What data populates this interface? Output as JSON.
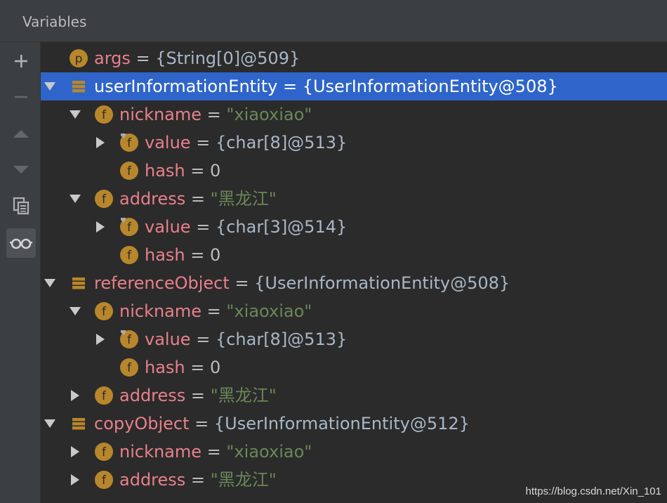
{
  "panel": {
    "title": "Variables"
  },
  "toolbar": {
    "buttons": [
      {
        "icon": "plus-icon"
      },
      {
        "icon": "minus-icon"
      },
      {
        "icon": "arrow-up-icon"
      },
      {
        "icon": "arrow-down-icon"
      },
      {
        "icon": "copy-icon"
      },
      {
        "icon": "glasses-icon"
      }
    ]
  },
  "colors": {
    "selection": "#2f65ca",
    "field_name": "#e8808c",
    "string_value": "#6a8759",
    "object_value": "#a9b7c6",
    "icon_badge": "#b8862b"
  },
  "tree": {
    "rows": [
      {
        "depth": 0,
        "expand": "none",
        "icon": "param-p-icon",
        "name": "args",
        "eq": " = ",
        "value": "{String[0]@509}",
        "value_type": "obj"
      },
      {
        "depth": 0,
        "expand": "expanded",
        "icon": "object-icon",
        "name": "userInformationEntity",
        "eq": " = ",
        "value": "{UserInformationEntity@508}",
        "value_type": "obj",
        "selected": true
      },
      {
        "depth": 1,
        "expand": "expanded",
        "icon": "field-f-icon",
        "name": "nickname",
        "eq": " = ",
        "value": "\"xiaoxiao\"",
        "value_type": "str"
      },
      {
        "depth": 2,
        "expand": "collapsed",
        "icon": "field-final-icon",
        "name": "value",
        "eq": " = ",
        "value": "{char[8]@513}",
        "value_type": "obj"
      },
      {
        "depth": 2,
        "expand": "none",
        "icon": "field-f-icon",
        "name": "hash",
        "eq": " = ",
        "value": "0",
        "value_type": "num"
      },
      {
        "depth": 1,
        "expand": "expanded",
        "icon": "field-f-icon",
        "name": "address",
        "eq": " = ",
        "value": "\"黑龙江\"",
        "value_type": "str"
      },
      {
        "depth": 2,
        "expand": "collapsed",
        "icon": "field-final-icon",
        "name": "value",
        "eq": " = ",
        "value": "{char[3]@514}",
        "value_type": "obj"
      },
      {
        "depth": 2,
        "expand": "none",
        "icon": "field-f-icon",
        "name": "hash",
        "eq": " = ",
        "value": "0",
        "value_type": "num"
      },
      {
        "depth": 0,
        "expand": "expanded",
        "icon": "object-icon",
        "name": "referenceObject",
        "eq": " = ",
        "value": "{UserInformationEntity@508}",
        "value_type": "obj"
      },
      {
        "depth": 1,
        "expand": "expanded",
        "icon": "field-f-icon",
        "name": "nickname",
        "eq": " = ",
        "value": "\"xiaoxiao\"",
        "value_type": "str"
      },
      {
        "depth": 2,
        "expand": "collapsed",
        "icon": "field-final-icon",
        "name": "value",
        "eq": " = ",
        "value": "{char[8]@513}",
        "value_type": "obj"
      },
      {
        "depth": 2,
        "expand": "none",
        "icon": "field-f-icon",
        "name": "hash",
        "eq": " = ",
        "value": "0",
        "value_type": "num"
      },
      {
        "depth": 1,
        "expand": "collapsed",
        "icon": "field-f-icon",
        "name": "address",
        "eq": " = ",
        "value": "\"黑龙江\"",
        "value_type": "str"
      },
      {
        "depth": 0,
        "expand": "expanded",
        "icon": "object-icon",
        "name": "copyObject",
        "eq": " = ",
        "value": "{UserInformationEntity@512}",
        "value_type": "obj"
      },
      {
        "depth": 1,
        "expand": "collapsed",
        "icon": "field-f-icon",
        "name": "nickname",
        "eq": " = ",
        "value": "\"xiaoxiao\"",
        "value_type": "str"
      },
      {
        "depth": 1,
        "expand": "collapsed",
        "icon": "field-f-icon",
        "name": "address",
        "eq": " = ",
        "value": "\"黑龙江\"",
        "value_type": "str"
      }
    ]
  },
  "watermark": "https://blog.csdn.net/Xin_101"
}
